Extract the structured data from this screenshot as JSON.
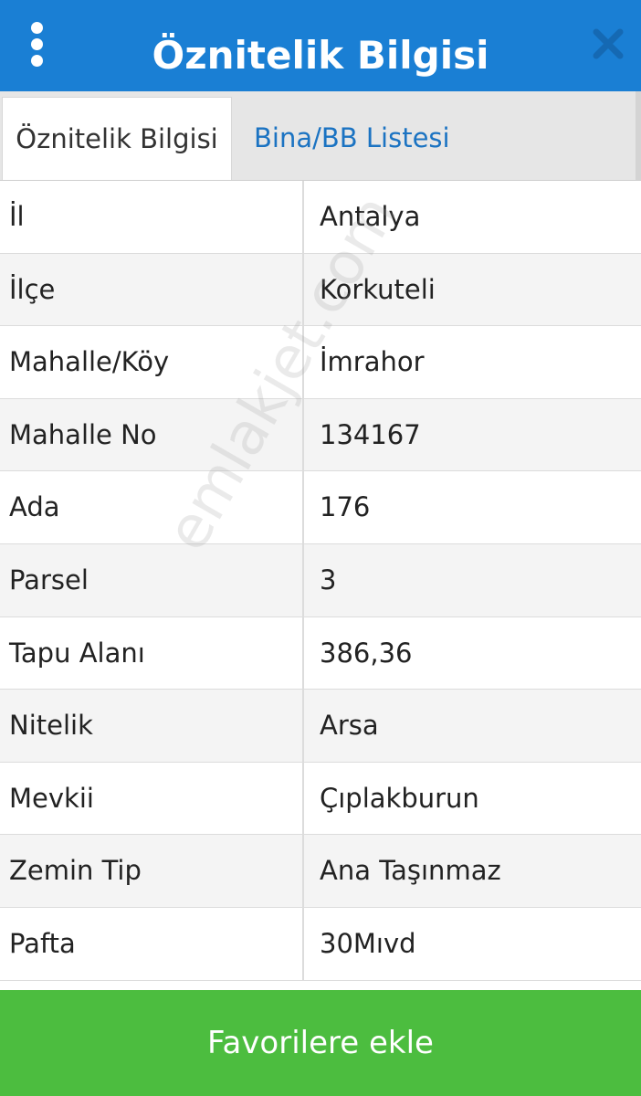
{
  "header": {
    "title": "Öznitelik Bilgisi",
    "bg_color": "#1a7fd4"
  },
  "tabs": [
    {
      "label": "Öznitelik Bilgisi",
      "active": true
    },
    {
      "label": "Bina/BB Listesi",
      "active": false
    }
  ],
  "attributes": [
    {
      "key": "İl",
      "value": "Antalya"
    },
    {
      "key": "İlçe",
      "value": "Korkuteli"
    },
    {
      "key": "Mahalle/Köy",
      "value": "İmrahor"
    },
    {
      "key": "Mahalle No",
      "value": "134167"
    },
    {
      "key": "Ada",
      "value": "176"
    },
    {
      "key": "Parsel",
      "value": "3"
    },
    {
      "key": "Tapu Alanı",
      "value": "386,36"
    },
    {
      "key": "Nitelik",
      "value": "Arsa"
    },
    {
      "key": "Mevkii",
      "value": "Çıplakburun"
    },
    {
      "key": "Zemin Tip",
      "value": "Ana Taşınmaz"
    },
    {
      "key": "Pafta",
      "value": "30Mıvd"
    }
  ],
  "footer": {
    "favorite_label": "Favorilere ekle",
    "button_color": "#4cbd3f"
  },
  "watermark": "emlakjet.com",
  "icons": {
    "menu": "more-vertical-icon",
    "close": "close-icon"
  }
}
